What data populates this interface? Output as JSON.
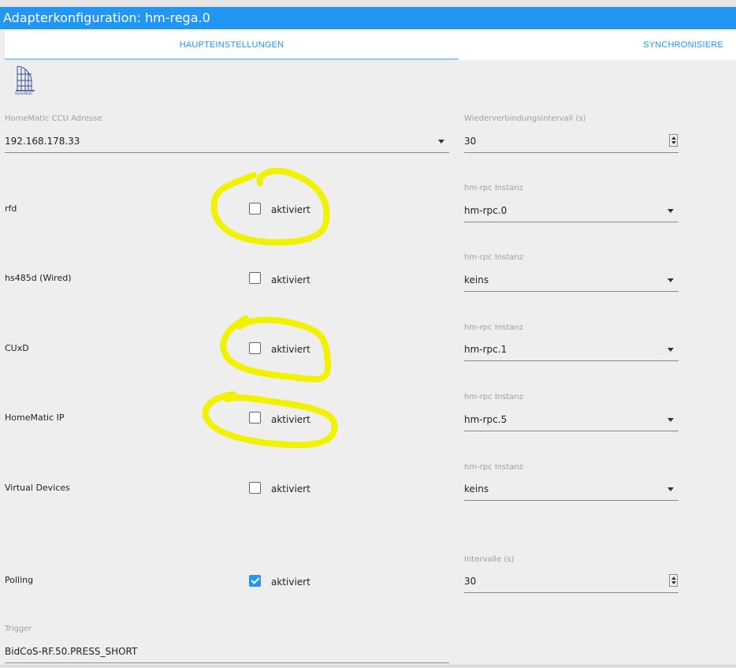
{
  "window": {
    "title": "Adapterkonfiguration: hm-rega.0"
  },
  "tabs": [
    {
      "label": "HAUPTEINSTELLUNGEN",
      "active": true
    },
    {
      "label": "SYNCHRONISIERE",
      "active": false
    }
  ],
  "logo": {
    "icon": "homematic-logo-icon",
    "text": "HomeMatic"
  },
  "ccu": {
    "label": "HomeMatic CCU Adresse",
    "value": "192.168.178.33"
  },
  "reconnect": {
    "label": "Wiederverbindungsintervall (s)",
    "value": "30"
  },
  "rows": [
    {
      "name": "rfd",
      "checkbox_label": "aktiviert",
      "checked": false,
      "instance_label": "hm-rpc Instanz",
      "instance_value": "hm-rpc.0"
    },
    {
      "name": "hs485d (Wired)",
      "checkbox_label": "aktiviert",
      "checked": false,
      "instance_label": "hm-rpc Instanz",
      "instance_value": "keins"
    },
    {
      "name": "CUxD",
      "checkbox_label": "aktiviert",
      "checked": false,
      "instance_label": "hm-rpc Instanz",
      "instance_value": "hm-rpc.1"
    },
    {
      "name": "HomeMatic IP",
      "checkbox_label": "aktiviert",
      "checked": false,
      "instance_label": "hm-rpc Instanz",
      "instance_value": "hm-rpc.5"
    },
    {
      "name": "Virtual Devices",
      "checkbox_label": "aktiviert",
      "checked": false,
      "instance_label": "hm-rpc Instanz",
      "instance_value": "keins"
    }
  ],
  "polling": {
    "name": "Polling",
    "checkbox_label": "aktiviert",
    "checked": true,
    "interval_label": "Intervalle (s)",
    "interval_value": "30"
  },
  "trigger": {
    "label": "Trigger",
    "value": "BidCoS-RF.50.PRESS_SHORT"
  },
  "colors": {
    "accent": "#2196f3",
    "highlight": "#f2f200",
    "background": "#eeeeee"
  }
}
